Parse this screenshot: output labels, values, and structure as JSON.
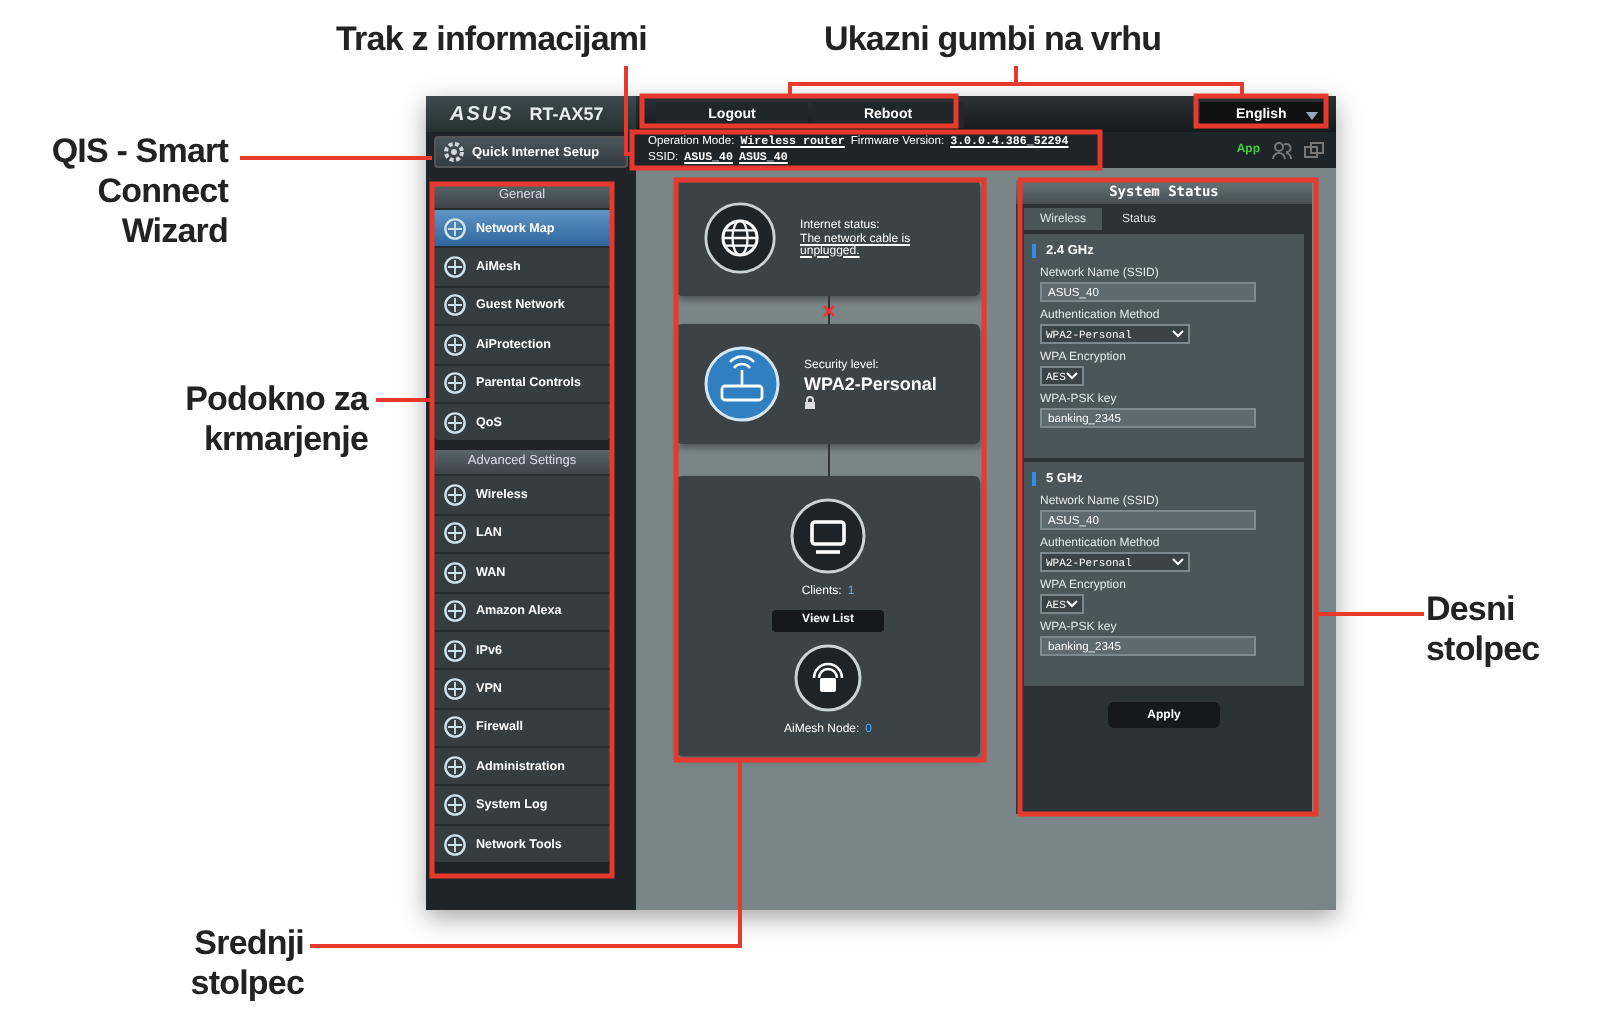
{
  "callouts": [
    {
      "text": "Trak z informacijami"
    },
    {
      "text": "Ukazni gumbi na vrhu"
    },
    {
      "text": "QIS - Smart Connect Wizard"
    },
    {
      "text": "Podokno za krmarjenje"
    },
    {
      "text": "Desni stolpec"
    },
    {
      "text": "Srednji stolpec"
    }
  ],
  "header": {
    "brand": "ASUS",
    "model": "RT-AX57",
    "buttons": [
      "Logout",
      "Reboot"
    ],
    "language": "English"
  },
  "info_bar": {
    "mode_label": "Operation Mode:",
    "mode": "Wireless router",
    "firmware_label": "Firmware Version:",
    "firmware": "3.0.0.4.386_52294",
    "ssid_label": "SSID:",
    "ssids": [
      "ASUS_40",
      "ASUS_40"
    ],
    "app": "App"
  },
  "qis": "Quick Internet Setup",
  "menu": [
    {
      "title": "General",
      "items": [
        {
          "label": "Network Map",
          "selected": true
        },
        {
          "label": "AiMesh",
          "selected": false
        },
        {
          "label": "Guest Network",
          "selected": false
        },
        {
          "label": "AiProtection",
          "selected": false
        },
        {
          "label": "Parental Controls",
          "selected": false
        },
        {
          "label": "QoS",
          "selected": false
        }
      ]
    },
    {
      "title": "Advanced Settings",
      "items": [
        {
          "label": "Wireless",
          "selected": false
        },
        {
          "label": "LAN",
          "selected": false
        },
        {
          "label": "WAN",
          "selected": false
        },
        {
          "label": "Amazon Alexa",
          "selected": false
        },
        {
          "label": "IPv6",
          "selected": false
        },
        {
          "label": "VPN",
          "selected": false
        },
        {
          "label": "Firewall",
          "selected": false
        },
        {
          "label": "Administration",
          "selected": false
        },
        {
          "label": "System Log",
          "selected": false
        },
        {
          "label": "Network Tools",
          "selected": false
        }
      ]
    }
  ],
  "network_map": {
    "internet": {
      "label": "Internet status:",
      "value": "The network cable is unplugged.",
      "connected": false
    },
    "security": {
      "label": "Security level:",
      "value": "WPA2-Personal"
    },
    "clients": {
      "label": "Clients:",
      "count": "1",
      "button": "View List"
    },
    "aimesh": {
      "label": "AiMesh Node:",
      "count": "0"
    }
  },
  "system_status": {
    "title": "System Status",
    "tabs": [
      {
        "label": "Wireless",
        "selected": true
      },
      {
        "label": "Status",
        "selected": false
      }
    ],
    "bands": [
      {
        "name": "2.4 GHz",
        "fields": [
          {
            "label": "Network Name (SSID)",
            "kind": "text",
            "value": "ASUS_40"
          },
          {
            "label": "Authentication Method",
            "kind": "select",
            "value": "WPA2-Personal"
          },
          {
            "label": "WPA Encryption",
            "kind": "short-select",
            "value": "AES"
          },
          {
            "label": "WPA-PSK key",
            "kind": "text",
            "value": "banking_2345"
          }
        ]
      },
      {
        "name": "5 GHz",
        "fields": [
          {
            "label": "Network Name (SSID)",
            "kind": "text",
            "value": "ASUS_40"
          },
          {
            "label": "Authentication Method",
            "kind": "select",
            "value": "WPA2-Personal"
          },
          {
            "label": "WPA Encryption",
            "kind": "short-select",
            "value": "AES"
          },
          {
            "label": "WPA-PSK key",
            "kind": "text",
            "value": "banking_2345"
          }
        ]
      }
    ],
    "apply": "Apply"
  }
}
